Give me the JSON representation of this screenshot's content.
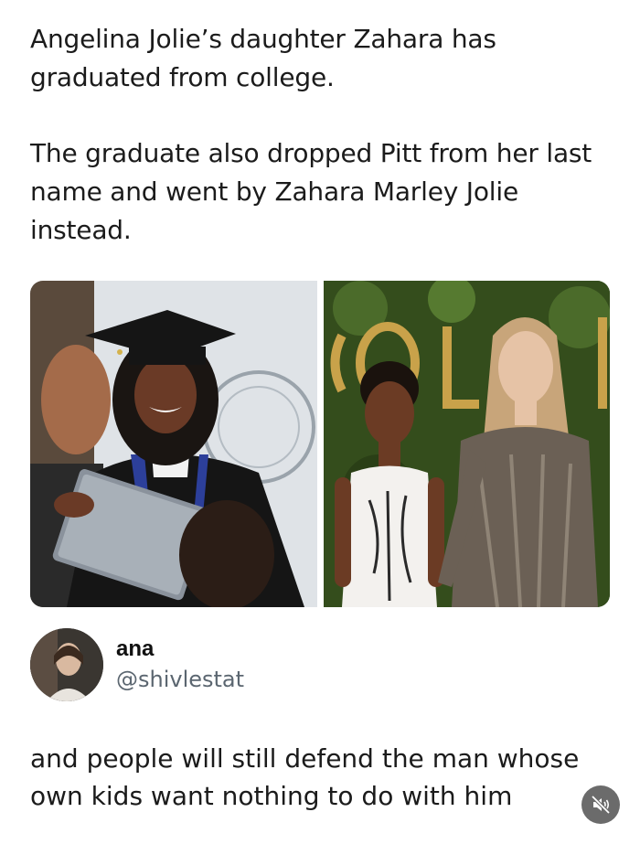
{
  "post": {
    "paragraph_1": "Angelina Jolie’s daughter Zahara has graduated from college.",
    "paragraph_2": "The graduate also dropped Pitt from her last name and went by Zahara Marley Jolie instead."
  },
  "photos": {
    "left_icon": "graduation-photo",
    "right_icon": "red-carpet-photo"
  },
  "reply": {
    "author_name": "ana",
    "author_handle": "@shivlestat",
    "text": "and people will still defend the man whose own kids want nothing to do with him"
  },
  "controls": {
    "mute_icon": "speaker-muted-icon"
  },
  "colors": {
    "text": "#1b1b1b",
    "handle": "#5b6670",
    "mute_button_bg": "#6b6b6b"
  }
}
